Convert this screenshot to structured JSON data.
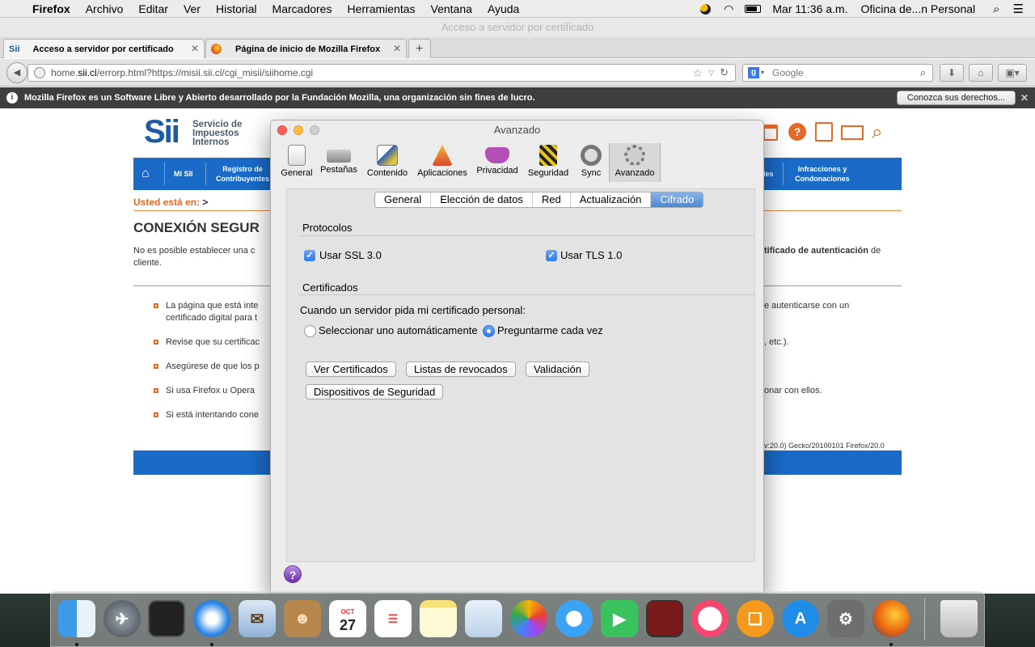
{
  "menubar": {
    "apple": "",
    "app_name": "Firefox",
    "items": [
      "Archivo",
      "Editar",
      "Ver",
      "Historial",
      "Marcadores",
      "Herramientas",
      "Ventana",
      "Ayuda"
    ],
    "clock": "Mar 11:36 a.m.",
    "user": "Oficina de...n Personal"
  },
  "window": {
    "title": "Acceso a servidor por certificado"
  },
  "tabs": [
    {
      "label": "Acceso a servidor por certificado",
      "active": true
    },
    {
      "label": "Página de inicio de Mozilla Firefox",
      "active": false
    }
  ],
  "navbar": {
    "url_prefix": "home.",
    "url_domain": "sii.cl",
    "url_rest": "/errorp.html?https://misii.sii.cl/cgi_misii/siihome.cgi",
    "search_placeholder": "Google"
  },
  "infobar": {
    "message": "Mozilla Firefox es un Software Libre y Abierto desarrollado por la Fundación Mozilla, una organización sin fines de lucro.",
    "button": "Conozca sus derechos..."
  },
  "page": {
    "logo": "Sii",
    "logo_sub": [
      "Servicio de",
      "Impuestos",
      "Internos"
    ],
    "nav": [
      "MI SII",
      "Registro de Contribuyentes",
      "les",
      "Infracciones y Condonaciones"
    ],
    "breadcrumb_label": "Usted está en:",
    "breadcrumb_sep": ">",
    "heading": "CONEXIÓN SEGUR",
    "intro_left": "No es posible establecer una c",
    "intro_left2": "cliente.",
    "intro_right_bold": "tificado de autenticación",
    "intro_right": "de",
    "bullets": [
      {
        "left": "La página que está inte",
        "left2": "certificado digital para t",
        "right": "e autenticarse con un"
      },
      {
        "left": "Revise que su certificac",
        "right": ", etc.)."
      },
      {
        "left": "Asegúrese de que los p",
        "right": ""
      },
      {
        "left": "Si usa Firefox u Opera",
        "right": "onar con ellos."
      },
      {
        "left": "Si está intentando cone",
        "right": ""
      }
    ],
    "useragent": "v:20.0) Gecko/20100101 Firefox/20.0"
  },
  "dialog": {
    "title": "Avanzado",
    "toolbar": [
      "General",
      "Pestañas",
      "Contenido",
      "Aplicaciones",
      "Privacidad",
      "Seguridad",
      "Sync",
      "Avanzado"
    ],
    "subtabs": [
      "General",
      "Elección de datos",
      "Red",
      "Actualización",
      "Cifrado"
    ],
    "active_subtab": "Cifrado",
    "protocols_label": "Protocolos",
    "ssl_label": "Usar SSL 3.0",
    "ssl_checked": true,
    "tls_label": "Usar TLS 1.0",
    "tls_checked": true,
    "certs_label": "Certificados",
    "certs_question": "Cuando un servidor pida mi certificado personal:",
    "radio_auto": "Seleccionar uno automáticamente",
    "radio_ask": "Preguntarme cada vez",
    "radio_selected": "ask",
    "buttons": [
      "Ver Certificados",
      "Listas de revocados",
      "Validación",
      "Dispositivos de Seguridad"
    ],
    "help": "?"
  },
  "dock": {
    "apps": [
      "Finder",
      "Launchpad",
      "Photo Booth",
      "Safari",
      "Mail",
      "Contacts",
      "Calendar",
      "Reminders",
      "Notes",
      "Preview",
      "Photos",
      "Messages",
      "FaceTime",
      "Photo Booth",
      "iTunes",
      "iBooks",
      "App Store",
      "System Preferences",
      "Firefox",
      "Trash"
    ],
    "calendar_month": "OCT",
    "calendar_day": "27"
  },
  "colors": {
    "accent": "#1a6ac8",
    "orange": "#e46a25",
    "selected_blue": "#3a7bd5"
  }
}
